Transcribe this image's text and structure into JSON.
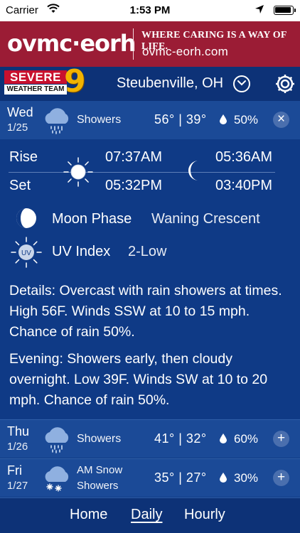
{
  "status_bar": {
    "carrier": "Carrier",
    "time": "1:53 PM"
  },
  "ad": {
    "logo": "ovmc·eorh",
    "tagline": "WHERE CARING IS A WAY OF LIFE.",
    "url": "ovmc-eorh.com",
    "background": "#9b1c35"
  },
  "header": {
    "brand_top": "SEVERE",
    "brand_bottom": "WEATHER TEAM",
    "brand_number": "9",
    "location": "Steubenville, OH"
  },
  "today": {
    "day": "Wed",
    "date": "1/25",
    "condition": "Showers",
    "high": "56°",
    "low": "39°",
    "temps": "56° | 39°",
    "precip": "50%",
    "toggle": "×"
  },
  "detail": {
    "rise_label": "Rise",
    "set_label": "Set",
    "sunrise": "07:37AM",
    "sunset": "05:32PM",
    "moonrise": "05:36AM",
    "moonset": "03:40PM",
    "moon_phase_label": "Moon Phase",
    "moon_phase_value": "Waning Crescent",
    "uv_label": "UV Index",
    "uv_value": "2-Low",
    "uv_icon_text": "UV",
    "details": "Details: Overcast with rain showers at times. High 56F. Winds SSW at 10 to 15 mph. Chance of rain 50%.",
    "evening": "Evening: Showers early, then cloudy overnight. Low 39F. Winds SW at 10 to 20 mph. Chance of rain 50%."
  },
  "days": [
    {
      "day": "Thu",
      "date": "1/26",
      "condition": "Showers",
      "temps": "41° | 32°",
      "precip": "60%",
      "toggle": "+"
    },
    {
      "day": "Fri",
      "date": "1/27",
      "condition_line1": "AM Snow",
      "condition_line2": "Showers",
      "temps": "35° | 27°",
      "precip": "30%",
      "toggle": "+"
    }
  ],
  "tabs": {
    "home": "Home",
    "daily": "Daily",
    "hourly": "Hourly"
  },
  "colors": {
    "background": "#113d86",
    "header": "#0d3277",
    "row": "#1b4a97",
    "accent_yellow": "#f2b300",
    "brand_red": "#c8102e"
  }
}
